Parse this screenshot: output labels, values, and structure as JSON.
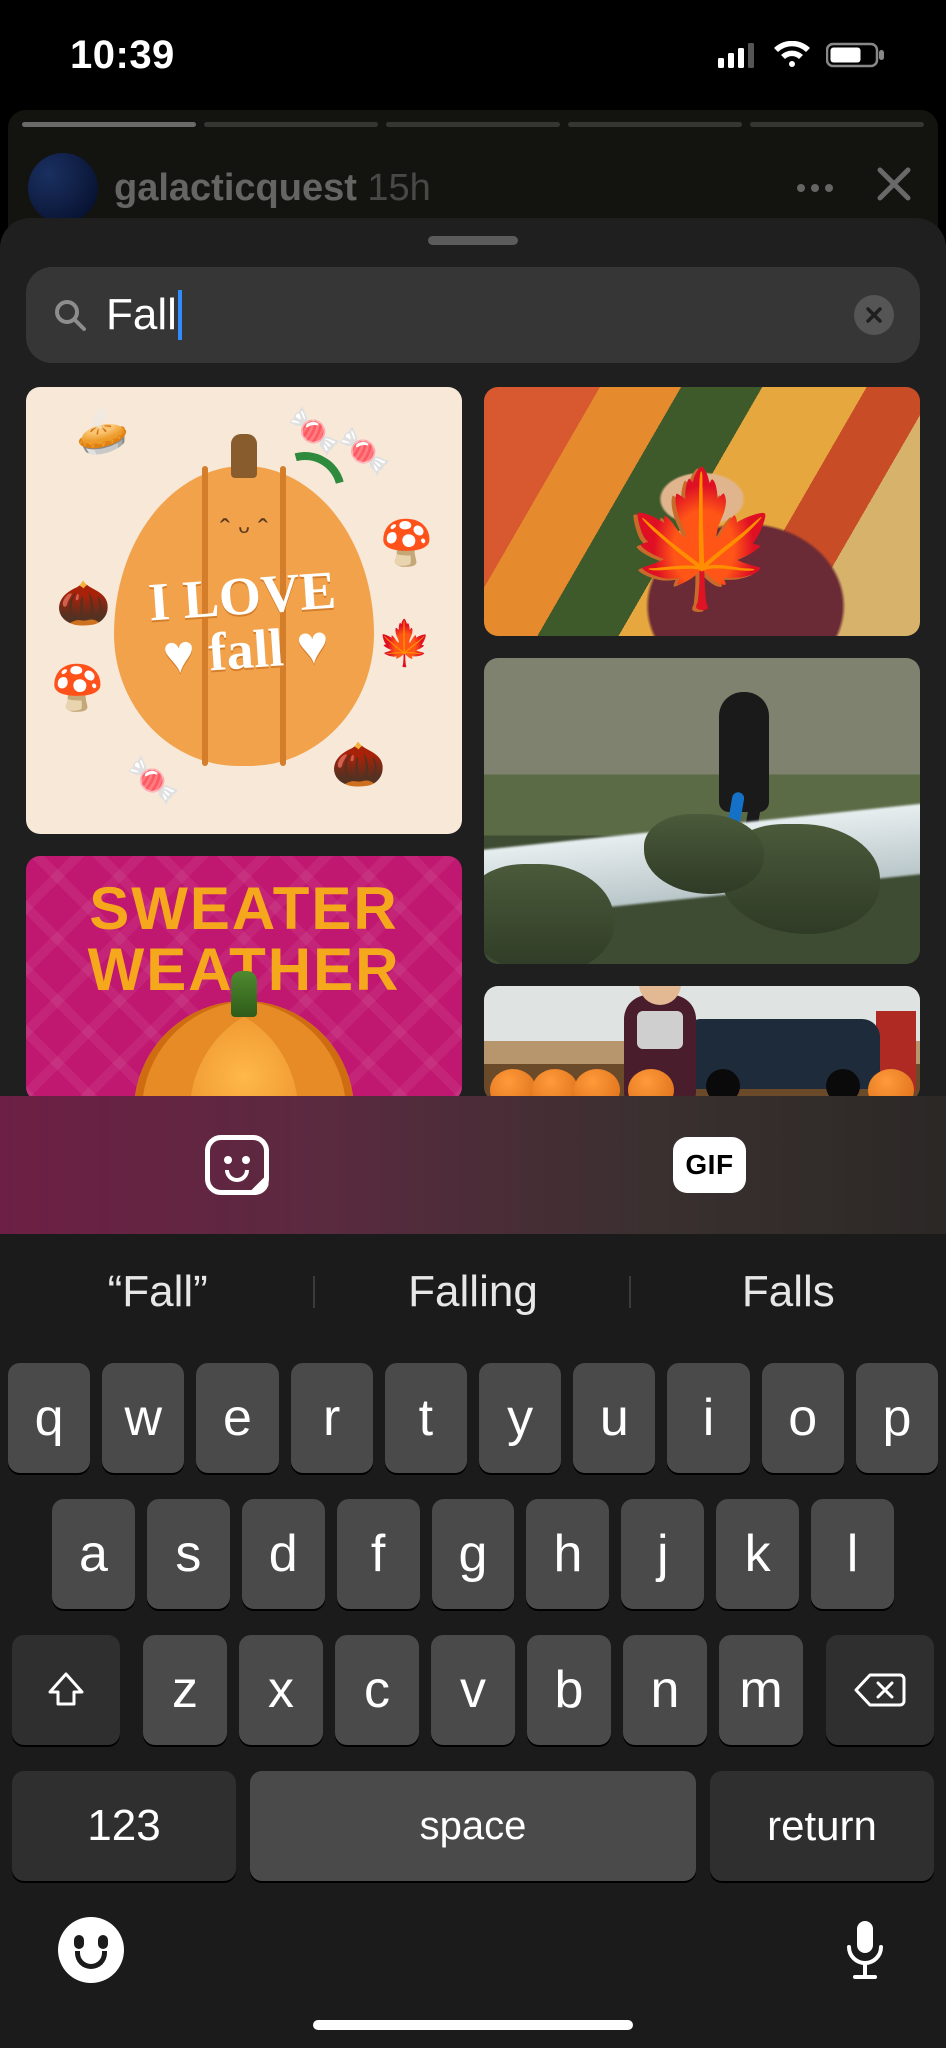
{
  "status": {
    "time": "10:39"
  },
  "story": {
    "username": "galacticquest",
    "age": "15h"
  },
  "search": {
    "value": "Fall"
  },
  "tiles": {
    "ilove_line1": "I LOVE",
    "ilove_line2": "♥ fall ♥",
    "sweater_line1": "SWEATER",
    "sweater_line2": "WEATHER"
  },
  "tabs": {
    "gif_label": "GIF"
  },
  "suggestions": [
    "“Fall”",
    "Falling",
    "Falls"
  ],
  "keyboard": {
    "row1": [
      "q",
      "w",
      "e",
      "r",
      "t",
      "y",
      "u",
      "i",
      "o",
      "p"
    ],
    "row2": [
      "a",
      "s",
      "d",
      "f",
      "g",
      "h",
      "j",
      "k",
      "l"
    ],
    "row3": [
      "z",
      "x",
      "c",
      "v",
      "b",
      "n",
      "m"
    ],
    "numbers": "123",
    "space": "space",
    "ret": "return"
  }
}
